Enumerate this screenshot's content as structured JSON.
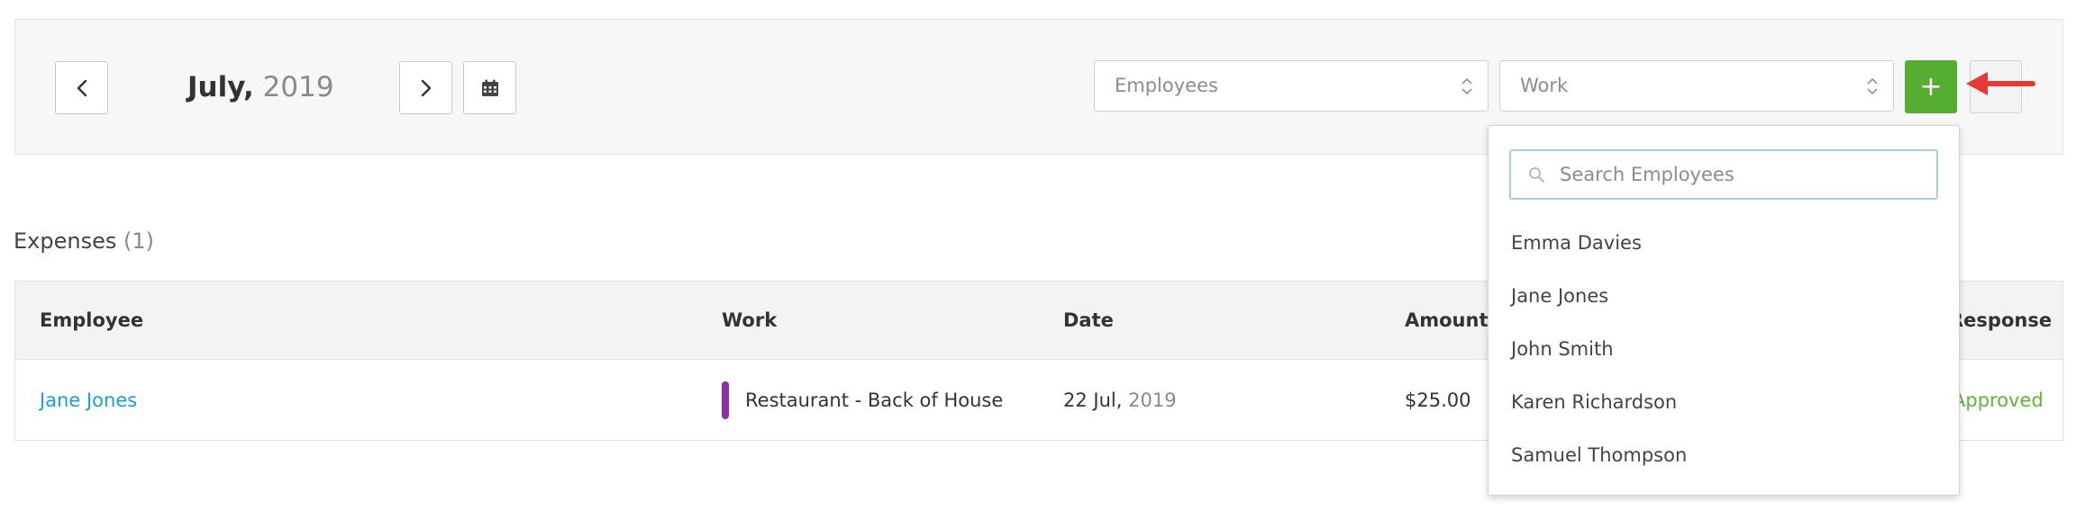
{
  "header": {
    "month": "July,",
    "year": "2019"
  },
  "filters": {
    "employees_placeholder": "Employees",
    "work_placeholder": "Work",
    "add_label": "+"
  },
  "section": {
    "title": "Expenses",
    "count": "(1)"
  },
  "table": {
    "columns": [
      "Employee",
      "Work",
      "Date",
      "Amount",
      "Response"
    ],
    "rows": [
      {
        "employee": "Jane Jones",
        "work": "Restaurant - Back of House",
        "work_color": "#8e2fa7",
        "date_day": "22 Jul,",
        "date_year": "2019",
        "amount": "$25.00",
        "response": "Approved"
      }
    ]
  },
  "dropdown": {
    "search_placeholder": "Search Employees",
    "options": [
      "Emma Davies",
      "Jane Jones",
      "John Smith",
      "Karen Richardson",
      "Samuel Thompson"
    ]
  },
  "colors": {
    "accent_green": "#55ae32",
    "link_blue": "#1a9fcf",
    "approved_green": "#5db53a",
    "annotation_red": "#e53935"
  },
  "icons": {
    "prev": "chevron-left-icon",
    "next": "chevron-right-icon",
    "calendar": "calendar-icon",
    "select_arrows": "up-down-arrows-icon",
    "search": "search-icon",
    "annotation": "red-arrow-icon"
  }
}
